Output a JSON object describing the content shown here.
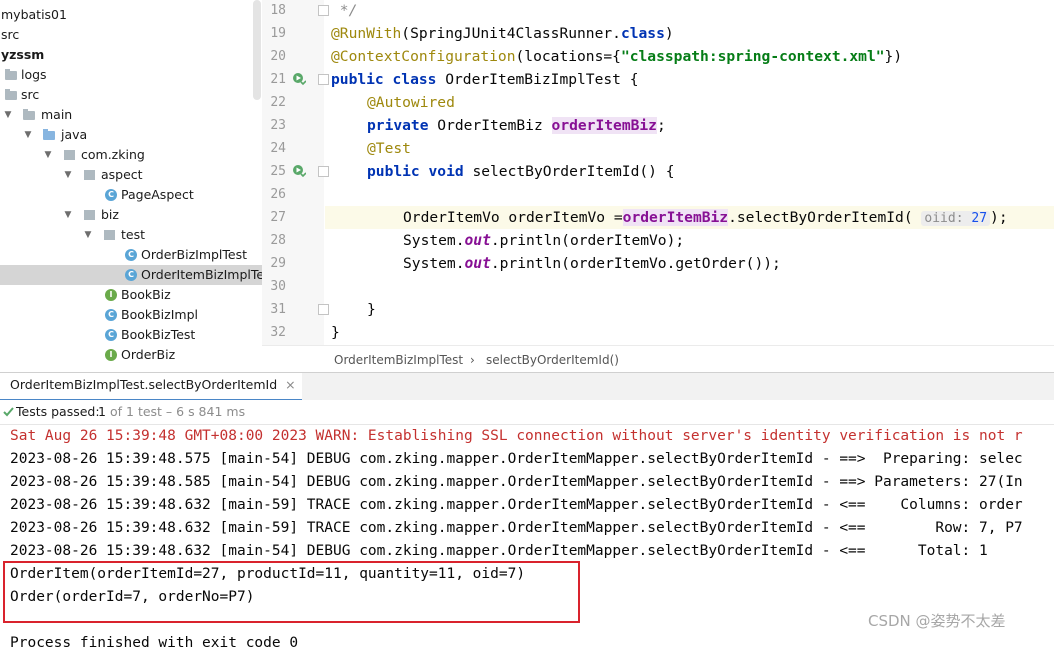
{
  "tree": {
    "items": [
      {
        "label": "mybatis01",
        "icon": "none",
        "bold": false
      },
      {
        "label": "src",
        "icon": "none",
        "bold": false
      },
      {
        "label": "yzssm",
        "icon": "none",
        "bold": true
      },
      {
        "label": "logs",
        "icon": "folder-icon",
        "bold": false
      },
      {
        "label": "src",
        "icon": "folder-icon",
        "bold": false
      },
      {
        "label": "main",
        "icon": "folder-icon",
        "bold": false
      },
      {
        "label": "java",
        "icon": "folder-icon",
        "bold": false
      },
      {
        "label": "com.zking",
        "icon": "package-icon",
        "bold": false
      },
      {
        "label": "aspect",
        "icon": "package-icon",
        "bold": false
      },
      {
        "label": "PageAspect",
        "icon": "class-icon",
        "bold": false
      },
      {
        "label": "biz",
        "icon": "package-icon",
        "bold": false
      },
      {
        "label": "test",
        "icon": "package-icon",
        "bold": false
      },
      {
        "label": "OrderBizImplTest",
        "icon": "test-class-icon",
        "bold": false
      },
      {
        "label": "OrderItemBizImplTes",
        "icon": "test-class-icon",
        "bold": false
      },
      {
        "label": "BookBiz",
        "icon": "interface-icon",
        "bold": false
      },
      {
        "label": "BookBizImpl",
        "icon": "class-icon",
        "bold": false
      },
      {
        "label": "BookBizTest",
        "icon": "class-icon",
        "bold": false
      },
      {
        "label": "OrderBiz",
        "icon": "interface-icon",
        "bold": false
      }
    ]
  },
  "editor": {
    "line_numbers": [
      "18",
      "19",
      "20",
      "21",
      "22",
      "23",
      "24",
      "25",
      "26",
      "27",
      "28",
      "29",
      "30",
      "31",
      "32"
    ],
    "code": {
      "l18": " */",
      "l19_ann": "@RunWith",
      "l19_rest": "(SpringJUnit4ClassRunner.",
      "l19_kw": "class",
      "l19_end": ")",
      "l20_ann": "@ContextConfiguration",
      "l20_rest": "(locations={",
      "l20_str": "\"classpath:spring-context.xml\"",
      "l20_end": "})",
      "l21_kw": "public class",
      "l21_rest": " OrderItemBizImplTest {",
      "l22_ann": "@Autowired",
      "l23_kw": "private",
      "l23_type": " OrderItemBiz ",
      "l23_field": "orderItemBiz",
      "l23_end": ";",
      "l24_ann": "@Test",
      "l25_kw": "public void",
      "l25_rest": " selectByOrderItemId() {",
      "l27_a": "OrderItemVo orderItemVo =",
      "l27_field": "orderItemBiz",
      "l27_b": ".selectByOrderItemId(",
      "l27_hint_name": "oiid:",
      "l27_hint_val": "27",
      "l27_end": ");",
      "l28_a": "System.",
      "l28_out": "out",
      "l28_b": ".println(orderItemVo);",
      "l29_a": "System.",
      "l29_out": "out",
      "l29_b": ".println(orderItemVo.getOrder());",
      "l31": "}",
      "l32": "}"
    },
    "breadcrumb": [
      "OrderItemBizImplTest",
      "selectByOrderItemId()"
    ],
    "breadcrumb_sep": "›"
  },
  "run": {
    "tab_label": "OrderItemBizImplTest.selectByOrderItemId",
    "tab_close": "×",
    "status_label": "Tests passed:",
    "status_count": "1",
    "status_rest": "of 1 test – 6 s 841 ms"
  },
  "console": {
    "lines": [
      "Sat Aug 26 15:39:48 GMT+08:00 2023 WARN: Establishing SSL connection without server's identity verification is not r",
      "2023-08-26 15:39:48.575 [main-54] DEBUG com.zking.mapper.OrderItemMapper.selectByOrderItemId - ==>  Preparing: selec",
      "2023-08-26 15:39:48.585 [main-54] DEBUG com.zking.mapper.OrderItemMapper.selectByOrderItemId - ==> Parameters: 27(In",
      "2023-08-26 15:39:48.632 [main-59] TRACE com.zking.mapper.OrderItemMapper.selectByOrderItemId - <==    Columns: order",
      "2023-08-26 15:39:48.632 [main-59] TRACE com.zking.mapper.OrderItemMapper.selectByOrderItemId - <==        Row: 7, P7",
      "2023-08-26 15:39:48.632 [main-54] DEBUG com.zking.mapper.OrderItemMapper.selectByOrderItemId - <==      Total: 1",
      "OrderItem(orderItemId=27, productId=11, quantity=11, oid=7)",
      "Order(orderId=7, orderNo=P7)",
      "",
      "Process finished with exit code 0"
    ]
  },
  "watermark": "CSDN @姿势不太差",
  "colors": {
    "keyword": "#0033b3",
    "annotation": "#9e880d",
    "string": "#067d17",
    "field": "#871094",
    "warn": "#c4312f",
    "highlight_box": "#d9232d"
  }
}
